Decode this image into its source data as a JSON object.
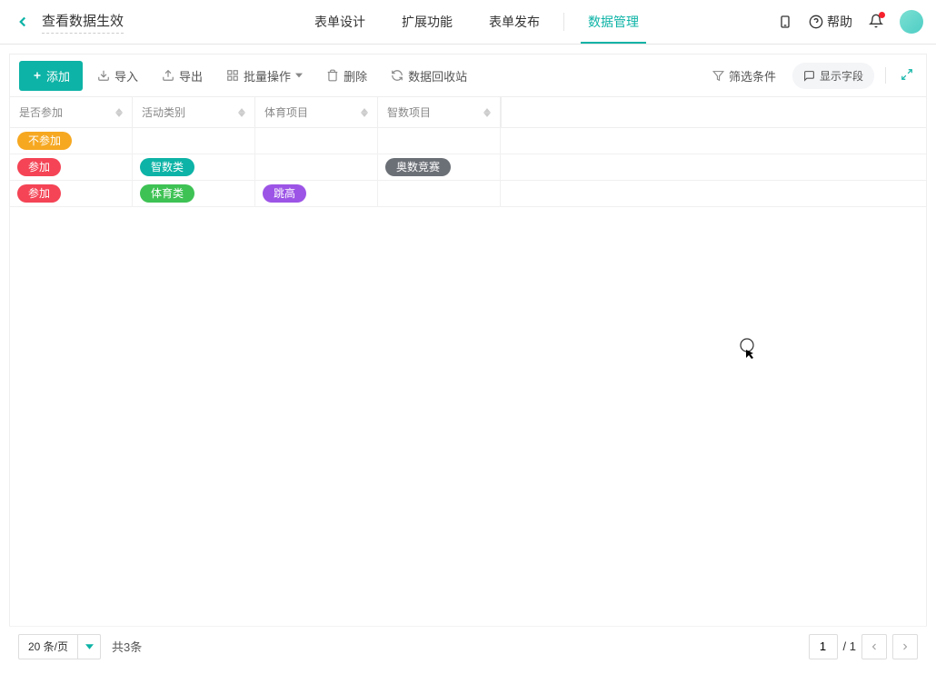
{
  "header": {
    "title": "查看数据生效",
    "tabs": [
      "表单设计",
      "扩展功能",
      "表单发布",
      "数据管理"
    ],
    "active_tab_index": 3,
    "help_label": "帮助"
  },
  "toolbar": {
    "add_label": "添加",
    "import_label": "导入",
    "export_label": "导出",
    "batch_label": "批量操作",
    "delete_label": "删除",
    "recycle_label": "数据回收站",
    "filter_label": "筛选条件",
    "fields_label": "显示字段"
  },
  "table": {
    "headers": [
      "是否参加",
      "活动类别",
      "体育项目",
      "智数项目"
    ],
    "rows": [
      {
        "cells": [
          {
            "text": "不参加",
            "color": "orange"
          },
          null,
          null,
          null
        ]
      },
      {
        "cells": [
          {
            "text": "参加",
            "color": "red"
          },
          {
            "text": "智数类",
            "color": "teal"
          },
          null,
          {
            "text": "奥数竞赛",
            "color": "gray"
          }
        ]
      },
      {
        "cells": [
          {
            "text": "参加",
            "color": "red"
          },
          {
            "text": "体育类",
            "color": "green"
          },
          {
            "text": "跳高",
            "color": "purple"
          },
          null
        ]
      }
    ]
  },
  "footer": {
    "page_size_label": "20 条/页",
    "total_label": "共3条",
    "current_page": "1",
    "total_pages_label": "/ 1"
  }
}
